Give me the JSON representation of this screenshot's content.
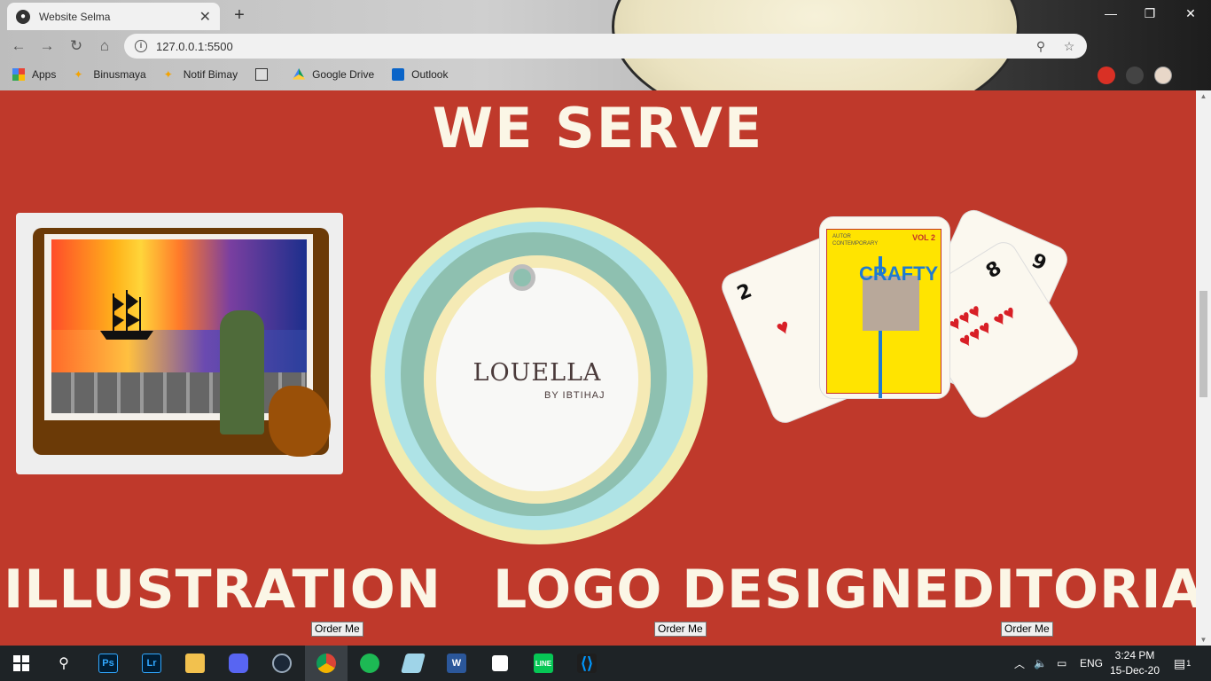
{
  "browser": {
    "tab_title": "Website Selma",
    "url": "127.0.0.1:5500",
    "bookmarks": [
      {
        "label": "Apps"
      },
      {
        "label": "Binusmaya"
      },
      {
        "label": "Notif Bimay"
      },
      {
        "label": ""
      },
      {
        "label": "Google Drive"
      },
      {
        "label": "Outlook"
      }
    ]
  },
  "page": {
    "heading": "WE SERVE",
    "services": [
      {
        "title": "ILLUSTRATION",
        "button": "Order Me"
      },
      {
        "title": "LOGO DESIGN",
        "button": "Order Me"
      },
      {
        "title": "EDITORIAL",
        "button": "Order Me"
      }
    ],
    "logo_brand": "LOUELLA",
    "logo_sub": "BY IBTIHAJ",
    "magazine_word": "CRAFTY",
    "magazine_vol": "VOL 2",
    "cards": {
      "left": "2",
      "right_top": "9",
      "right_mid": "8"
    },
    "colors": {
      "page_bg": "#bf392b",
      "title": "#fbf6e6"
    }
  },
  "taskbar": {
    "language": "ENG",
    "time": "3:24 PM",
    "date": "15-Dec-20",
    "notifications": "1"
  }
}
